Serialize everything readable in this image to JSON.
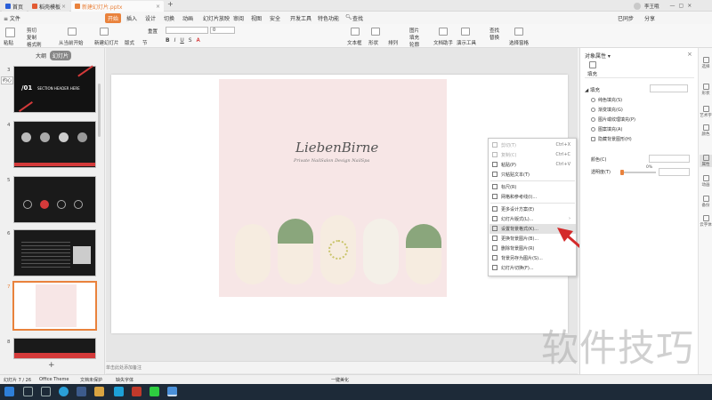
{
  "titlebar": {
    "tabs": [
      {
        "label": "首页",
        "color": "#2b5fd8"
      },
      {
        "label": "稻壳模板",
        "color": "#e25a32"
      },
      {
        "label": "新建幻灯片.pptx",
        "color": "#e9823c"
      }
    ],
    "add_tab": "+",
    "user": "李王哦"
  },
  "menubar": {
    "file": "≡ 文件",
    "items": [
      "开始",
      "插入",
      "设计",
      "切换",
      "动画",
      "幻灯片放映",
      "审阅",
      "视图",
      "安全",
      "开发工具",
      "特色功能"
    ],
    "active": "开始",
    "search": "查找",
    "sync": "已同步",
    "share": "分享"
  },
  "ribbon": {
    "paste": "粘贴",
    "cut": "剪切",
    "copy": "复制",
    "format_painter": "格式刷",
    "from_current": "从当前开始",
    "new_slide": "新建幻灯片",
    "layout": "版式",
    "section": "节",
    "reset": "重置",
    "font_size": "0",
    "text_box": "文本框",
    "shape": "形状",
    "arrange": "排列",
    "picture": "图片",
    "fill": "填充",
    "outline": "轮廓",
    "doc_assist": "文档助手",
    "presenter": "演示工具",
    "find": "查找",
    "replace": "替换",
    "select_pane": "选择窗格"
  },
  "leftpanel": {
    "tab_outline": "大纲",
    "tab_slides": "幻灯片",
    "slide_numbers": [
      "3",
      "4",
      "5",
      "6",
      "7",
      "8"
    ],
    "slide3_text": "SECTION HEADER HERE",
    "slide3_num": "/01",
    "add_button": "+",
    "tooltip": "约心"
  },
  "slide": {
    "logo_text": "LiebenBirne",
    "tagline": "Private  NailSalon  Design  NailSpa"
  },
  "contextmenu": {
    "items": [
      {
        "label": "剪切(T)",
        "shortcut": "Ctrl+X",
        "disabled": true
      },
      {
        "label": "复制(C)",
        "shortcut": "Ctrl+C",
        "disabled": true
      },
      {
        "label": "粘贴(P)",
        "shortcut": "Ctrl+V",
        "disabled": false
      },
      {
        "label": "只粘贴文本(T)",
        "shortcut": "",
        "disabled": false
      },
      {
        "label": "标尺(R)",
        "shortcut": "",
        "disabled": false
      },
      {
        "label": "网格和参考线(I)...",
        "shortcut": "",
        "disabled": false
      },
      {
        "label": "更多设计方案(E)",
        "shortcut": "",
        "disabled": false
      },
      {
        "label": "幻灯片版式(L)...",
        "shortcut": "›",
        "disabled": false
      },
      {
        "label": "设置背景格式(K)...",
        "shortcut": "",
        "disabled": false,
        "highlight": true
      },
      {
        "label": "更换背景图片(B)...",
        "shortcut": "",
        "disabled": false
      },
      {
        "label": "删除背景图片(R)",
        "shortcut": "",
        "disabled": false
      },
      {
        "label": "背景另存为图片(S)...",
        "shortcut": "",
        "disabled": false
      },
      {
        "label": "幻灯片切换(F)...",
        "shortcut": "",
        "disabled": false
      }
    ]
  },
  "rightpanel": {
    "title": "对象属性 ▾",
    "tab": "填充",
    "section": "◢ 填充",
    "options": [
      "纯色填充(S)",
      "渐变填充(G)",
      "图片或纹理填充(P)",
      "图案填充(A)",
      "隐藏背景图形(H)"
    ],
    "color_label": "颜色(C)",
    "transparency_label": "透明度(T)",
    "transparency_value": "0%",
    "transparency_fraction": 0.0
  },
  "rightbar": {
    "items": [
      "选择",
      "形状",
      "艺术字",
      "颜色",
      "属性",
      "动画",
      "备份",
      "云字体"
    ]
  },
  "notes": {
    "placeholder": "单击此处添加备注"
  },
  "statusbar": {
    "slide_info": "幻灯片 7 / 26",
    "theme": "Office Theme",
    "doc_protect": "文档未保护",
    "missing_font": "缺失字体",
    "beautify": "一键美化"
  },
  "watermark": "软件技巧",
  "colors": {
    "accent": "#e9823c",
    "arrow": "#d42a2a",
    "taskbar": "#1d2a38"
  }
}
